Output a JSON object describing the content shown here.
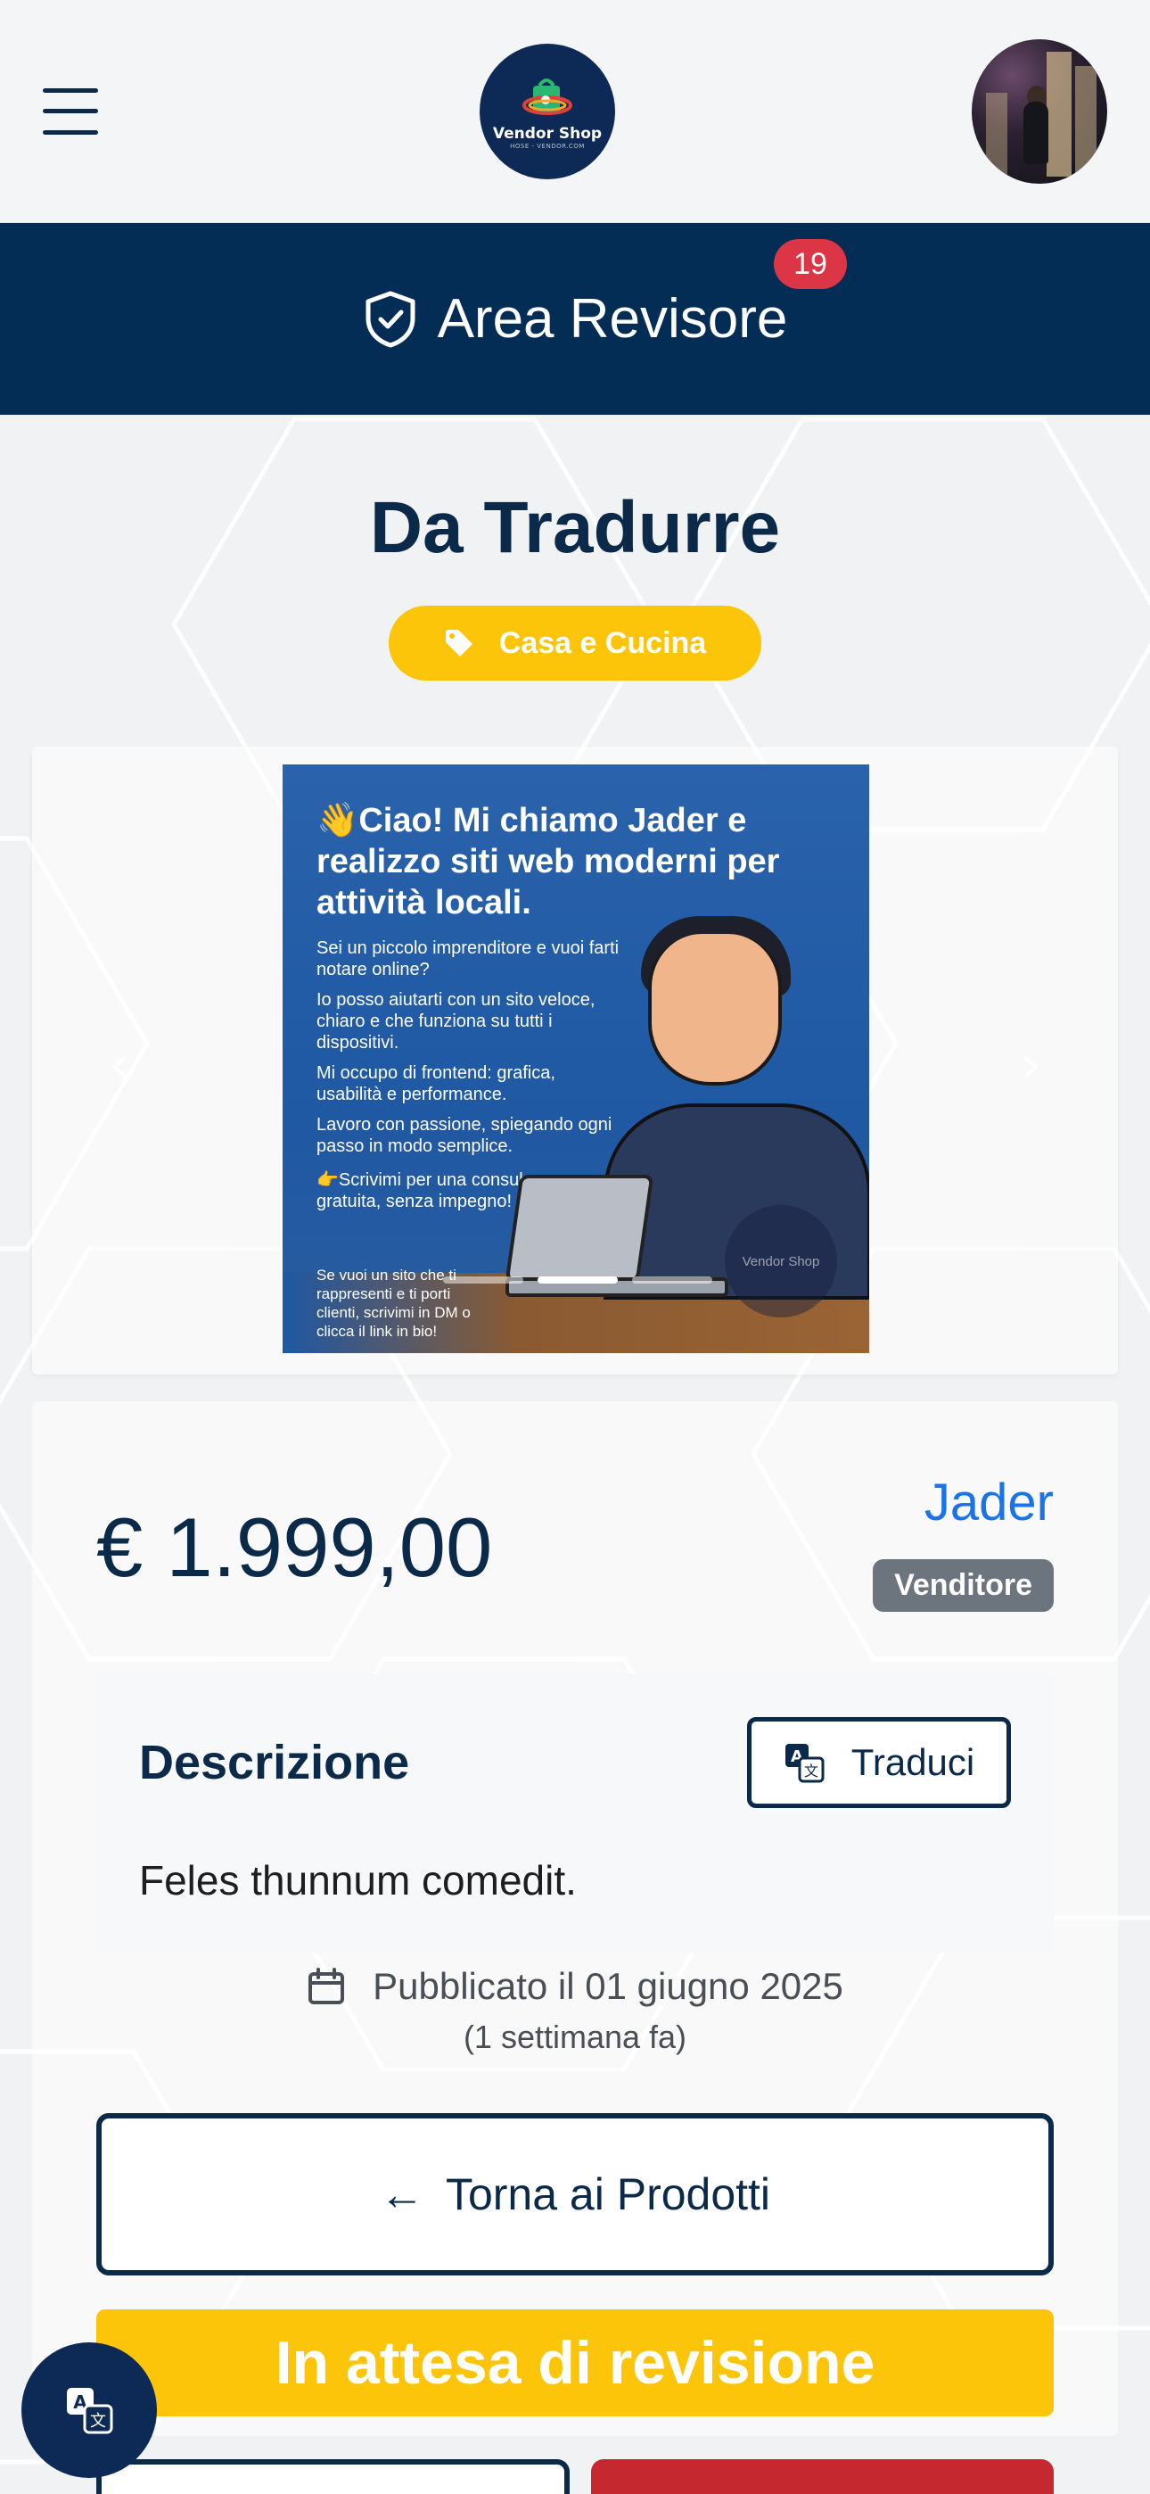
{
  "navbar": {
    "logo_brand": "Vendor Shop",
    "logo_sub": "HOSE - VENDOR.COM"
  },
  "banner": {
    "title": "Area Revisore",
    "notification_count": "19"
  },
  "product": {
    "title": "Da Tradurre",
    "category": "Casa e Cucina",
    "price": "€ 1.999,00",
    "seller_name": "Jader",
    "seller_role": "Venditore",
    "description_title": "Descrizione",
    "translate_label": "Traduci",
    "description_text": "Feles thunnum comedit.",
    "published": "Pubblicato il 01 giugno 2025",
    "published_relative": "(1 settimana fa)",
    "back_label": "Torna ai Prodotti",
    "status": "In attesa di revisione"
  },
  "slide": {
    "heading": "👋Ciao! Mi chiamo Jader e realizzo siti web moderni per attività locali.",
    "p1": "Sei un piccolo imprenditore e vuoi farti notare online?",
    "p2": "Io posso aiutarti con un sito veloce, chiaro e che funziona su tutti i dispositivi.",
    "p3": "Mi occupo di frontend: grafica, usabilità e performance.",
    "p4": "Lavoro con passione, spiegando ogni passo in modo semplice.",
    "p5": "👉Scrivimi per una consulenza gratuita, senza impegno!",
    "p6": "Se vuoi un sito che ti rappresenti e ti porti clienti, scrivimi in DM o clicca il link in bio!",
    "watermark": "Vendor Shop"
  },
  "colors": {
    "navy": "#032d55",
    "accent_yellow": "#fdc50a",
    "badge_red": "#dc3545",
    "link_blue": "#1a73e8",
    "secondary_grey": "#6c757d"
  },
  "icons": {
    "menu": "hamburger-icon",
    "banner": "shield-check-icon",
    "category": "tag-icon",
    "translate": "translate-icon",
    "date": "calendar-icon"
  }
}
